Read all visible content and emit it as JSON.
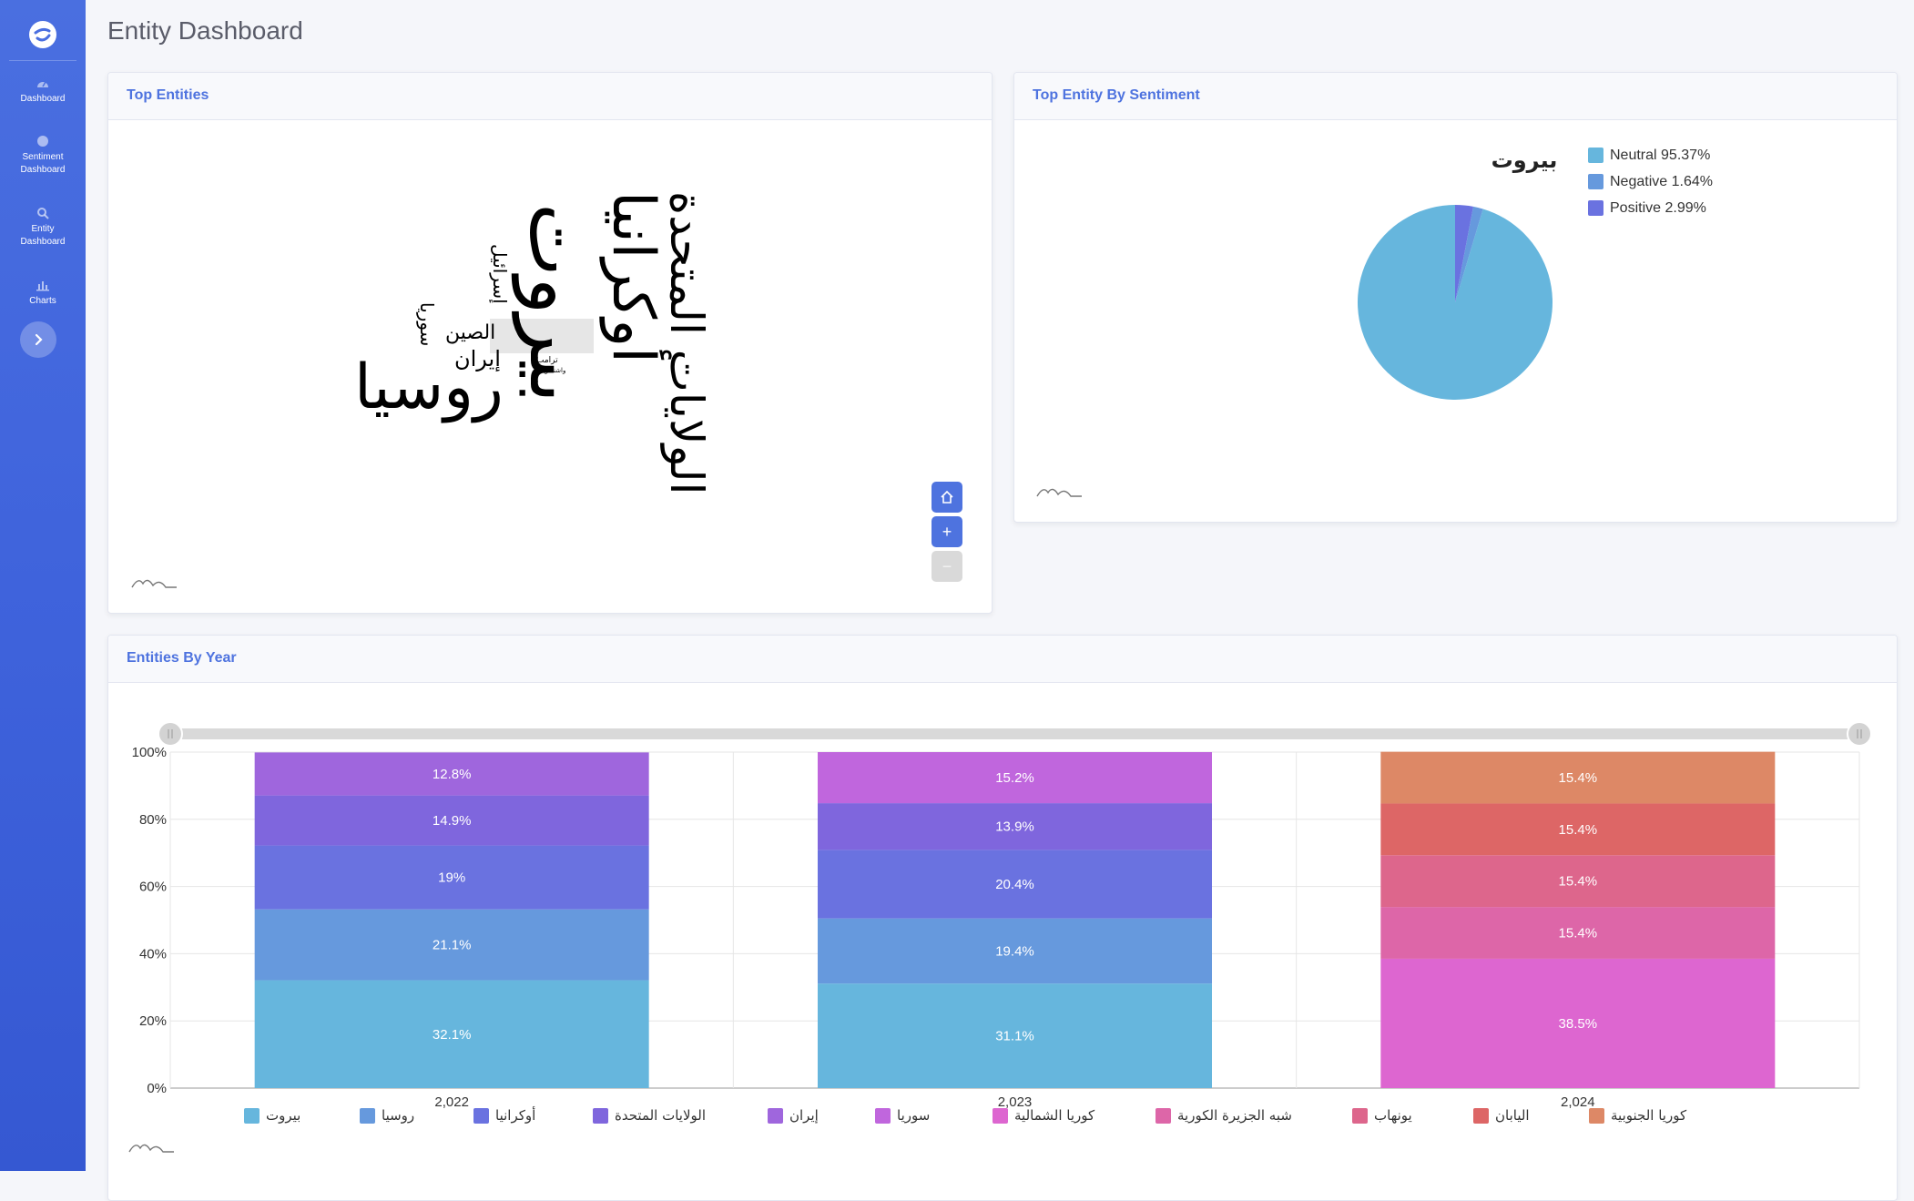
{
  "sidebar": {
    "items": [
      {
        "label": "Dashboard",
        "icon": "gauge-icon"
      },
      {
        "label": "Sentiment Dashboard",
        "icon": "circle-icon"
      },
      {
        "label": "Entity Dashboard",
        "icon": "search-icon"
      },
      {
        "label": "Charts",
        "icon": "bar-chart-icon"
      }
    ],
    "toggle_icon": "chevron-right-icon"
  },
  "page": {
    "title": "Entity Dashboard"
  },
  "top_entities": {
    "title": "Top Entities",
    "words": [
      "بيروت",
      "أوكرانيا",
      "الولايات المتحدة",
      "روسيا",
      "إيران",
      "الصين",
      "سوريا",
      "إسرائيل",
      "ترامب",
      "واشنطن"
    ],
    "zoom": {
      "home": "⌂",
      "plus": "+",
      "minus": "−"
    }
  },
  "sentiment": {
    "title": "Top Entity By Sentiment",
    "chart_title": "بيروت",
    "legend": [
      "Neutral 95.37%",
      "Negative 1.64%",
      "Positive 2.99%"
    ]
  },
  "by_year": {
    "title": "Entities By Year"
  },
  "chart_data": [
    {
      "type": "pie",
      "title": "بيروت",
      "labels": [
        "Neutral",
        "Negative",
        "Positive"
      ],
      "values": [
        95.37,
        1.64,
        2.99
      ],
      "colors": [
        "#66b6dd",
        "#6699dd",
        "#6a72e0"
      ],
      "legend_position": "top-right"
    },
    {
      "type": "bar",
      "stacked": "percent",
      "categories": [
        "2,022",
        "2,023",
        "2,024"
      ],
      "y_ticks": [
        "0%",
        "20%",
        "40%",
        "60%",
        "80%",
        "100%"
      ],
      "ylim": [
        0,
        100
      ],
      "grid": true,
      "legend_position": "bottom",
      "series": [
        {
          "name": "بيروت",
          "color": "#66b6dd",
          "values": [
            32.1,
            31.1,
            0
          ],
          "labels": [
            "32.1%",
            "31.1%",
            ""
          ]
        },
        {
          "name": "روسيا",
          "color": "#6699dd",
          "values": [
            21.1,
            19.4,
            0
          ],
          "labels": [
            "21.1%",
            "19.4%",
            ""
          ]
        },
        {
          "name": "أوكرانيا",
          "color": "#6a72e0",
          "values": [
            19,
            20.4,
            0
          ],
          "labels": [
            "19%",
            "20.4%",
            ""
          ]
        },
        {
          "name": "الولايات المتحدة",
          "color": "#7f66dd",
          "values": [
            14.9,
            13.9,
            0
          ],
          "labels": [
            "14.9%",
            "13.9%",
            ""
          ]
        },
        {
          "name": "إيران",
          "color": "#9f66dd",
          "values": [
            12.8,
            0,
            0
          ],
          "labels": [
            "12.8%",
            "",
            ""
          ]
        },
        {
          "name": "سوريا",
          "color": "#c066dd",
          "values": [
            0,
            15.2,
            0
          ],
          "labels": [
            "",
            "15.2%",
            ""
          ]
        },
        {
          "name": "كوريا الشمالية",
          "color": "#dd66d0",
          "values": [
            0,
            0,
            38.5
          ],
          "labels": [
            "",
            "",
            "38.5%"
          ]
        },
        {
          "name": "شبه الجزيرة الكورية",
          "color": "#dd66a8",
          "values": [
            0,
            0,
            15.4
          ],
          "labels": [
            "",
            "",
            "15.4%"
          ]
        },
        {
          "name": "يونهاب",
          "color": "#dd668c",
          "values": [
            0,
            0,
            15.4
          ],
          "labels": [
            "",
            "",
            "15.4%"
          ]
        },
        {
          "name": "اليابان",
          "color": "#dd6666",
          "values": [
            0,
            0,
            15.4
          ],
          "labels": [
            "",
            "",
            "15.4%"
          ]
        },
        {
          "name": "كوريا الجنوبية",
          "color": "#dd8866",
          "values": [
            0,
            0,
            15.4
          ],
          "labels": [
            "",
            "",
            "15.4%"
          ]
        }
      ]
    }
  ]
}
